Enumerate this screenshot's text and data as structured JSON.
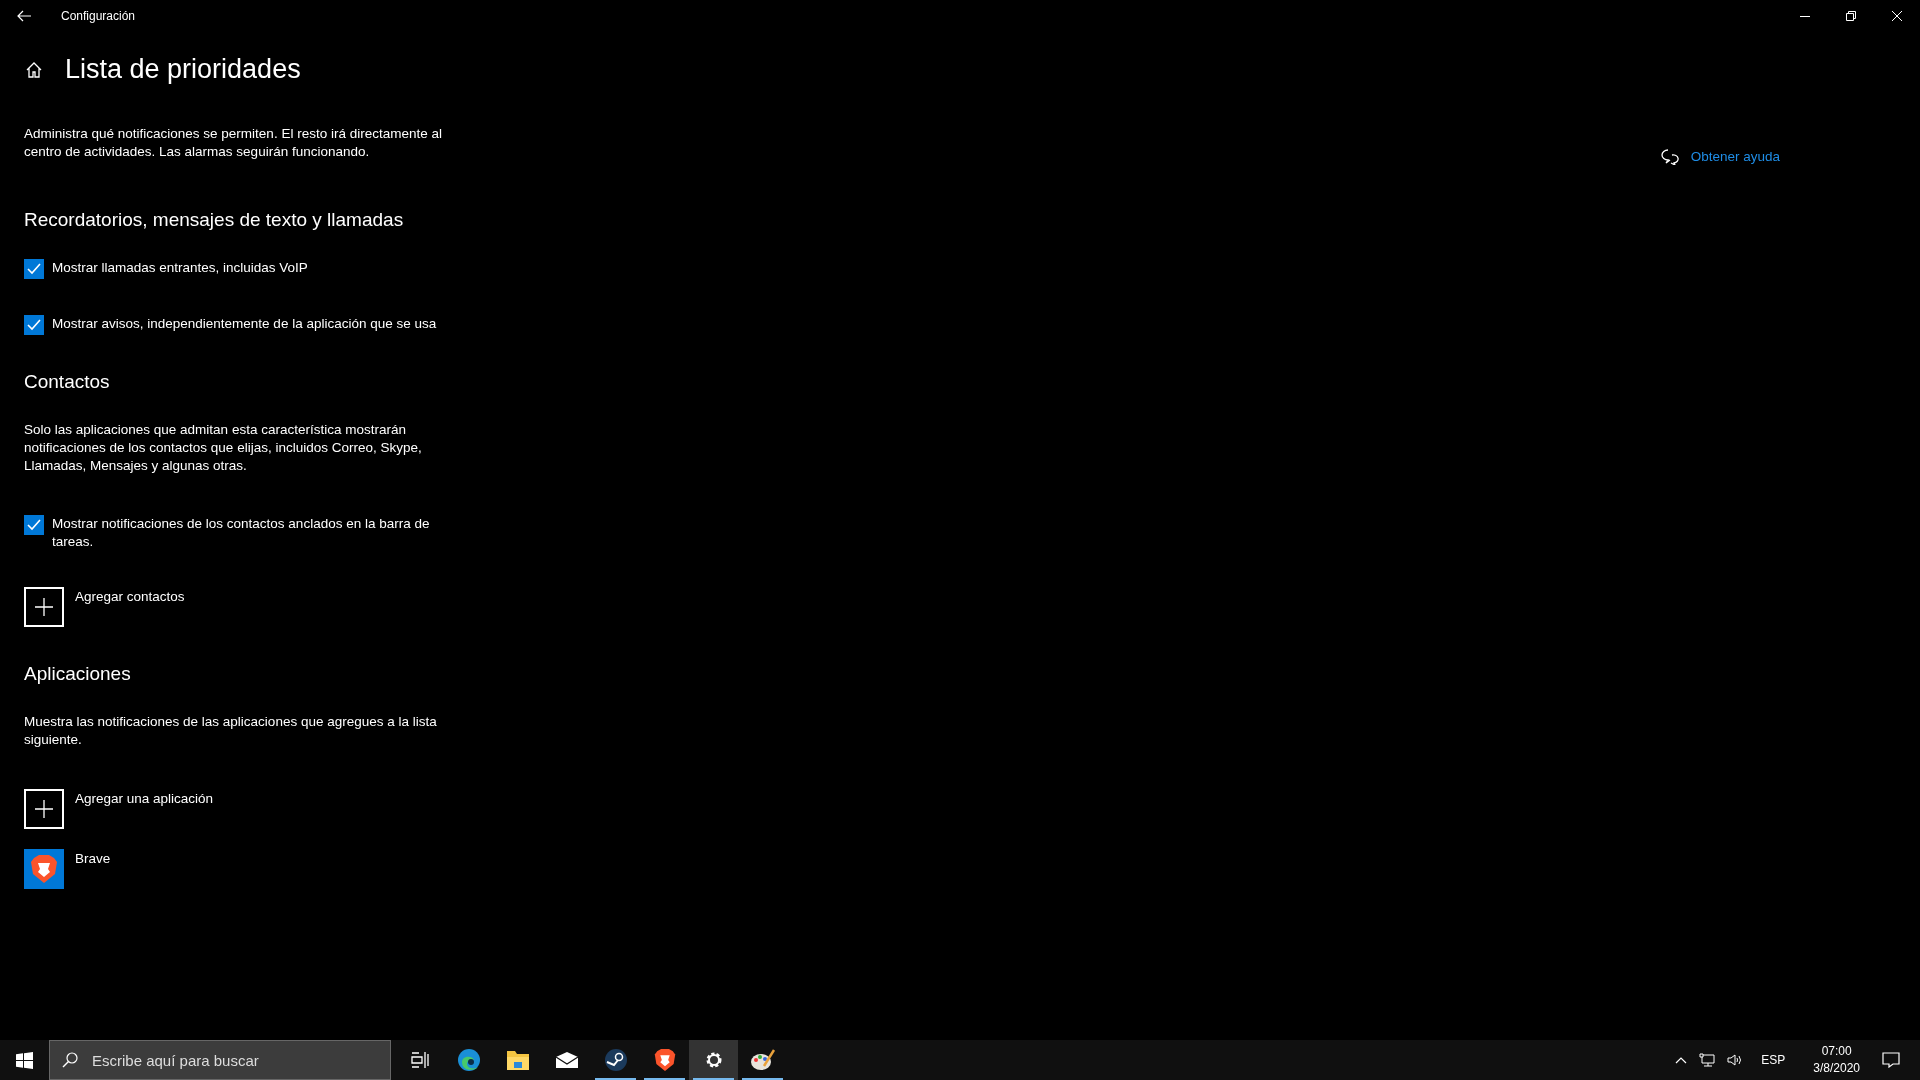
{
  "window": {
    "title": "Configuración"
  },
  "page": {
    "title": "Lista de prioridades",
    "description": "Administra qué notificaciones se permiten. El resto irá directamente al centro de actividades. Las alarmas seguirán funcionando."
  },
  "help_link": "Obtener ayuda",
  "sections": [
    {
      "heading": "Recordatorios, mensajes de texto y llamadas",
      "items": [
        {
          "kind": "checkbox",
          "label": "Mostrar llamadas entrantes, incluidas VoIP",
          "checked": true
        },
        {
          "kind": "checkbox",
          "label": "Mostrar avisos, independientemente de la aplicación que se usa",
          "checked": true
        }
      ]
    },
    {
      "heading": "Contactos",
      "description": "Solo las aplicaciones que admitan esta característica mostrarán notificaciones de los contactos que elijas, incluidos Correo, Skype, Llamadas, Mensajes y algunas otras.",
      "items": [
        {
          "kind": "checkbox",
          "label": "Mostrar notificaciones de los contactos anclados en la barra de tareas.",
          "checked": true
        },
        {
          "kind": "add",
          "label": "Agregar contactos"
        }
      ]
    },
    {
      "heading": "Aplicaciones",
      "description": "Muestra las notificaciones de las aplicaciones que agregues a la lista siguiente.",
      "items": [
        {
          "kind": "add",
          "label": "Agregar una aplicación"
        },
        {
          "kind": "app",
          "label": "Brave"
        }
      ]
    }
  ],
  "taskbar": {
    "search": {
      "placeholder": "Escribe aquí para buscar"
    },
    "apps": [
      {
        "kind": "taskview",
        "running": false,
        "selected": false
      },
      {
        "kind": "edge",
        "running": false,
        "selected": false
      },
      {
        "kind": "explorer",
        "running": false,
        "selected": false
      },
      {
        "kind": "mail",
        "running": false,
        "selected": false
      },
      {
        "kind": "steam",
        "running": true,
        "selected": false
      },
      {
        "kind": "brave",
        "running": true,
        "selected": false
      },
      {
        "kind": "settings",
        "running": true,
        "selected": true
      },
      {
        "kind": "paint",
        "running": true,
        "selected": false
      }
    ],
    "tray": {
      "language": "ESP",
      "time": "07:00",
      "date": "3/8/2020"
    }
  }
}
